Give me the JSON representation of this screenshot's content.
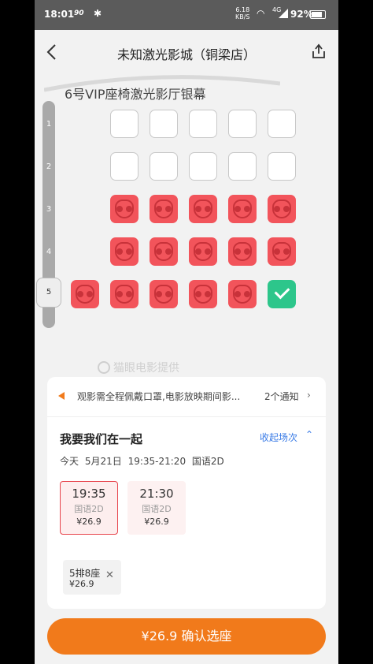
{
  "status_bar": {
    "time": "18:01",
    "network": "90",
    "speed": "6.18",
    "speed_unit": "KB/S",
    "lte": "4G",
    "battery": "92%"
  },
  "header": {
    "title": "未知激光影城（铜梁店）"
  },
  "screen": {
    "hall_name": "6号VIP座椅激光影厅银幕"
  },
  "rows": [
    "1",
    "2",
    "3",
    "4",
    "5"
  ],
  "selected_row_label": "5",
  "seat_map": [
    [
      "empty",
      "empty",
      "empty",
      "empty",
      "empty"
    ],
    [
      "empty",
      "empty",
      "empty",
      "empty",
      "empty"
    ],
    [
      "sold",
      "sold",
      "sold",
      "sold",
      "sold"
    ],
    [
      "sold",
      "sold",
      "sold",
      "sold",
      "sold"
    ],
    [
      "sold",
      "sold",
      "sold",
      "sold",
      "sold",
      "selected"
    ]
  ],
  "watermark": "猫眼电影提供",
  "notice": {
    "text": "观影需全程佩戴口罩,电影放映期间影...",
    "count": "2个通知"
  },
  "movie": {
    "title": "我要我们在一起",
    "collapse_label": "收起场次",
    "day": "今天",
    "date": "5月21日",
    "time_range": "19:35-21:20",
    "format": "国语2D"
  },
  "showtimes": [
    {
      "time": "19:35",
      "lang": "国语2D",
      "price": "¥26.9"
    },
    {
      "time": "21:30",
      "lang": "国语2D",
      "price": "¥26.9"
    }
  ],
  "selected_seat": {
    "label": "5排8座",
    "price": "¥26.9"
  },
  "confirm_button": {
    "label": "¥26.9 确认选座"
  },
  "colors": {
    "accent": "#f17a1b",
    "sold": "#f2545b",
    "selected": "#2dc68b",
    "link": "#3a7be6"
  }
}
